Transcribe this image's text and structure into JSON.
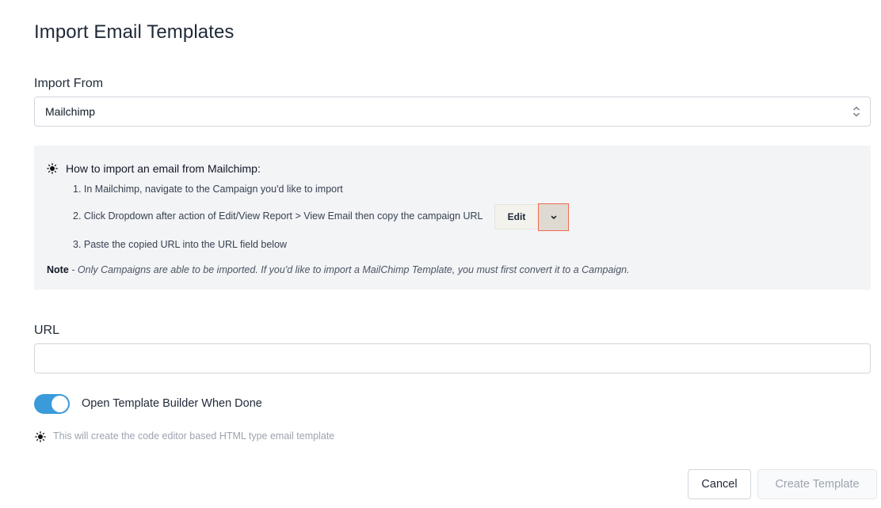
{
  "page": {
    "title": "Import Email Templates"
  },
  "import_from": {
    "label": "Import From",
    "selected": "Mailchimp"
  },
  "info": {
    "title": "How to import an email from Mailchimp:",
    "steps": [
      "1. In Mailchimp, navigate to the Campaign you'd like to import",
      "2. Click Dropdown after action of Edit/View Report > View Email then copy the campaign URL",
      "3. Paste the copied URL into the URL field below"
    ],
    "edit_label": "Edit",
    "note_label": "Note",
    "note_text": " - Only Campaigns are able to be imported. If you'd like to import a MailChimp Template, you must first convert it to a Campaign."
  },
  "url": {
    "label": "URL",
    "value": "",
    "placeholder": ""
  },
  "toggle": {
    "label": "Open Template Builder When Done",
    "on": true
  },
  "hint": "This will create the code editor based HTML type email template",
  "actions": {
    "cancel": "Cancel",
    "create": "Create Template"
  },
  "colors": {
    "toggle_on": "#3b9ad9",
    "highlight_border": "#ef6b50",
    "info_bg": "#f3f4f6"
  }
}
